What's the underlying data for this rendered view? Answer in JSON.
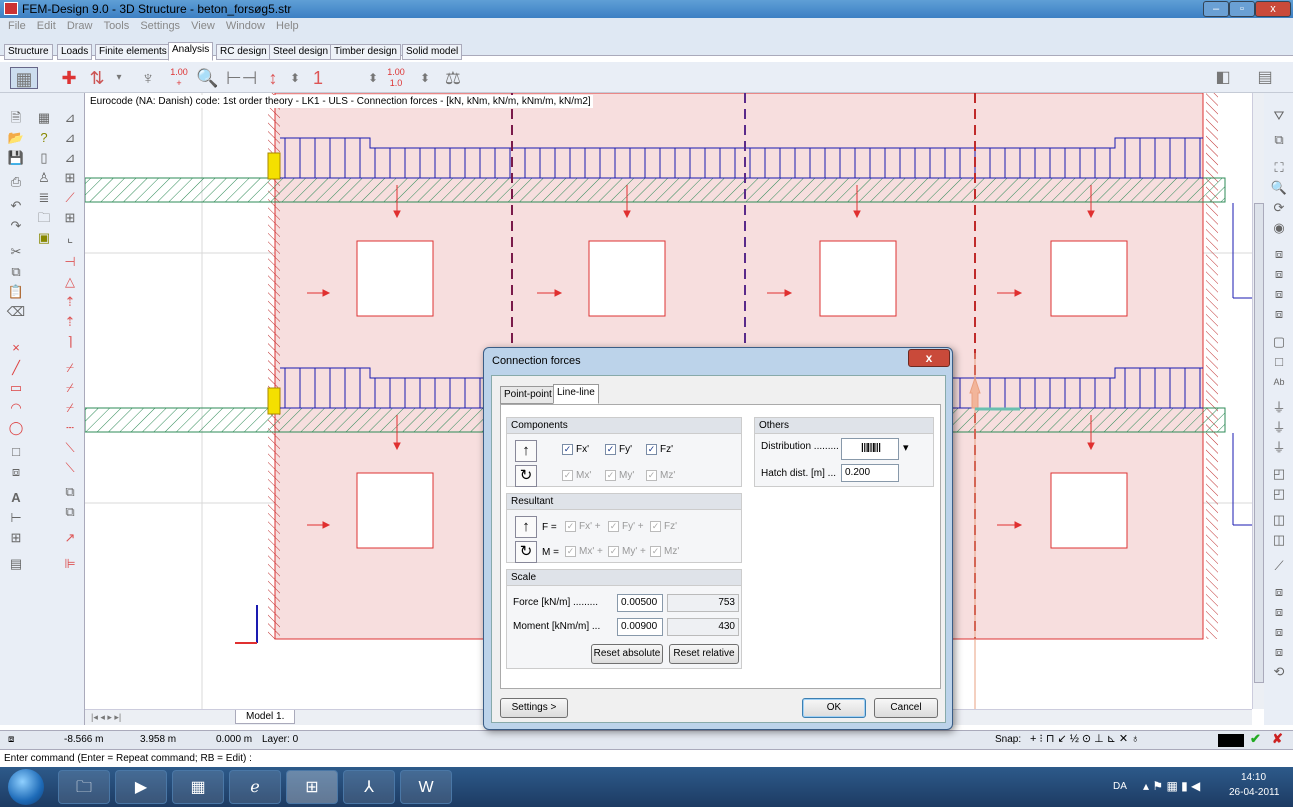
{
  "window": {
    "title": "FEM-Design 9.0 - 3D Structure - beton_forsøg5.str",
    "min_label": "–",
    "max_label": "▫",
    "close_label": "x"
  },
  "menu": [
    "File",
    "Edit",
    "Draw",
    "Tools",
    "Settings",
    "View",
    "Window",
    "Help"
  ],
  "tabs": [
    "Structure",
    "Loads",
    "Finite elements",
    "Analysis",
    "RC design",
    "Steel design",
    "Timber design",
    "Solid model"
  ],
  "active_tab": "Analysis",
  "toolbar": {
    "icons": [
      "calculator-icon",
      "plus-icon",
      "arrows-updown-icon",
      "support-icon",
      "scale-up-icon",
      "zoom-icon",
      "frame-icon",
      "arrow-scale-icon",
      "spinner-icon",
      "one-icon",
      "spinner2-icon",
      "scale-value-icon",
      "spinner3-icon",
      "balance-icon"
    ],
    "scale1": "1.00",
    "scale2": "1.00",
    "scale3": "1.0"
  },
  "canvas": {
    "caption": "Eurocode (NA: Danish) code: 1st order theory - LK1 - ULS - Connection forces - [kN, kNm, kN/m, kNm/m, kN/m2]"
  },
  "model_tab": "Model 1.",
  "status": {
    "x": "-8.566 m",
    "y": "3.958 m",
    "z": "0.000 m",
    "layer": "Layer: 0",
    "snap": "Snap:"
  },
  "command_prompt": "Enter command (Enter = Repeat command; RB = Edit) :",
  "taskbar": {
    "lang": "DA",
    "time": "14:10",
    "date": "26-04-2011"
  },
  "dialog": {
    "title": "Connection forces",
    "close": "x",
    "tabs": [
      "Point-point",
      "Line-line"
    ],
    "active_tab": "Line-line",
    "components": {
      "title": "Components",
      "force_checks": [
        {
          "label": "Fx'",
          "checked": true
        },
        {
          "label": "Fy'",
          "checked": true
        },
        {
          "label": "Fz'",
          "checked": true
        }
      ],
      "moment_checks": [
        {
          "label": "Mx'",
          "checked": true
        },
        {
          "label": "My'",
          "checked": true
        },
        {
          "label": "Mz'",
          "checked": true
        }
      ]
    },
    "resultant": {
      "title": "Resultant",
      "f_prefix": "F =",
      "m_prefix": "M =",
      "f_terms": [
        "Fx' +",
        "Fy' +",
        "Fz'"
      ],
      "m_terms": [
        "Mx' +",
        "My' +",
        "Mz'"
      ]
    },
    "scale": {
      "title": "Scale",
      "force_label": "Force [kN/m] .........",
      "force_value": "0.00500",
      "force_abs": "753",
      "moment_label": "Moment [kNm/m] ...",
      "moment_value": "0.00900",
      "moment_abs": "430",
      "reset_absolute": "Reset absolute",
      "reset_relative": "Reset relative"
    },
    "others": {
      "title": "Others",
      "distribution_label": "Distribution .........",
      "hatch_label": "Hatch dist. [m] ...",
      "hatch_value": "0.200"
    },
    "settings_button": "Settings >",
    "ok_button": "OK",
    "cancel_button": "Cancel"
  },
  "colors": {
    "panel_fill": "#f7dede",
    "load_blue": "#1a1ab0",
    "force_red": "#e03030",
    "hatch_green": "#2e8b57"
  }
}
